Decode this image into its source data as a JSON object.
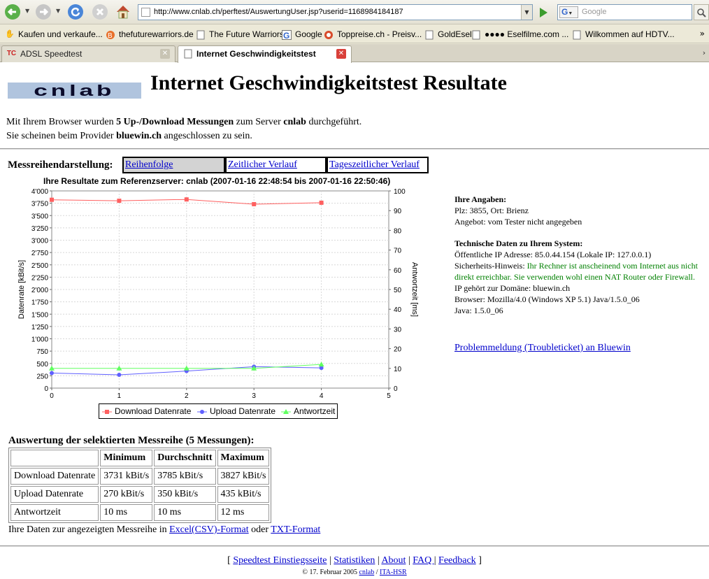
{
  "browser": {
    "url": "http://www.cnlab.ch/perftest/AuswertungUser.jsp?userid=1168984184187",
    "search_placeholder": "Google",
    "search_engine_letter": "G",
    "bookmarks": [
      {
        "label": "Kaufen und verkaufe...",
        "icon": "hand-icon"
      },
      {
        "label": "thefuturewarriors.de",
        "icon": "globe-icon"
      },
      {
        "label": "The Future Warriors",
        "icon": "page-icon"
      },
      {
        "label": "Google",
        "icon": "google-icon"
      },
      {
        "label": "Toppreise.ch - Preisv...",
        "icon": "toppreise-icon"
      },
      {
        "label": "GoldEsel",
        "icon": "page-icon"
      },
      {
        "label": "●●●● Eselfilme.com ...",
        "icon": "page-icon"
      },
      {
        "label": "Wilkommen auf HDTV...",
        "icon": "page-icon"
      }
    ],
    "bookmarks_more": "»",
    "tabs": [
      {
        "label": "ADSL Speedtest",
        "favicon": "TC",
        "active": false
      },
      {
        "label": "Internet Geschwindigkeitstest",
        "favicon": "",
        "active": true
      }
    ]
  },
  "page": {
    "logo_text": "cnlab",
    "title": "Internet Geschwindigkeitstest Resultate",
    "intro": {
      "line1_a": "Mit Ihrem Browser wurden ",
      "line1_b": "5 Up-/Download Messungen",
      "line1_c": " zum Server ",
      "line1_d": "cnlab",
      "line1_e": " durchgeführt.",
      "line2_a": "Sie scheinen beim Provider ",
      "line2_b": "bluewin.ch",
      "line2_c": " angeschlossen zu sein."
    },
    "series_label": "Messreihendarstellung:",
    "series_buttons": [
      "Reihenfolge",
      "Zeitlicher Verlauf",
      "Tageszeitlicher Verlauf"
    ]
  },
  "chart_data": {
    "type": "line",
    "title": "Ihre Resultate zum Referenzserver: cnlab (2007-01-16 22:48:54 bis 2007-01-16 22:50:46)",
    "xlabel": "",
    "ylabel": "Datenrate [kBit/s]",
    "y2label": "Antwortzeit [ms]",
    "x": [
      0,
      1,
      2,
      3,
      4
    ],
    "xlim": [
      0,
      5
    ],
    "xticks": [
      "0",
      "1",
      "2",
      "3",
      "4",
      "5"
    ],
    "ylim": [
      0,
      4000
    ],
    "yticks": [
      "0",
      "250",
      "500",
      "750",
      "1'000",
      "1'250",
      "1'500",
      "1'750",
      "2'000",
      "2'250",
      "2'500",
      "2'750",
      "3'000",
      "3'250",
      "3'500",
      "3'750",
      "4'000"
    ],
    "y2lim": [
      0,
      100
    ],
    "y2ticks": [
      "0",
      "10",
      "20",
      "30",
      "40",
      "50",
      "60",
      "70",
      "80",
      "90",
      "100"
    ],
    "grid": true,
    "legend_position": "bottom",
    "series": [
      {
        "name": "Download Datenrate",
        "axis": "left",
        "color": "#ff6060",
        "marker": "square",
        "values": [
          3820,
          3800,
          3827,
          3731,
          3760
        ]
      },
      {
        "name": "Upload Datenrate",
        "axis": "left",
        "color": "#6060ff",
        "marker": "circle",
        "values": [
          305,
          270,
          345,
          435,
          410
        ]
      },
      {
        "name": "Antwortzeit",
        "axis": "right",
        "color": "#60ff60",
        "marker": "triangle",
        "values": [
          10,
          10,
          10,
          10,
          12
        ]
      }
    ]
  },
  "info": {
    "section1_title": "Ihre Angaben:",
    "plz": "Plz: 3855, Ort: Brienz",
    "offer": "Angebot: vom Tester nicht angegeben",
    "section2_title": "Technische Daten zu Ihrem System:",
    "ip": "Öffentliche IP Adresse: 85.0.44.154 (Lokale IP: 127.0.0.1)",
    "security_label": "Sicherheits-Hinweis: ",
    "security_text": "Ihr Rechner ist anscheinend vom Internet aus nicht direkt erreichbar. Sie verwenden wohl einen NAT Router oder Firewall.",
    "domain": "IP gehört zur Domäne: bluewin.ch",
    "browser": "Browser: Mozilla/4.0 (Windows XP 5.1) Java/1.5.0_06",
    "java": "Java: 1.5.0_06",
    "ticket_link": "Problemmeldung (Troubleticket) an Bluewin"
  },
  "evaluation": {
    "title": "Auswertung der selektierten Messreihe (5 Messungen):",
    "headers": [
      "",
      "Minimum",
      "Durchschnitt",
      "Maximum"
    ],
    "rows": [
      [
        "Download Datenrate",
        "3731 kBit/s",
        "3785 kBit/s",
        "3827 kBit/s"
      ],
      [
        "Upload Datenrate",
        "270 kBit/s",
        "350 kBit/s",
        "435 kBit/s"
      ],
      [
        "Antwortzeit",
        "10 ms",
        "10 ms",
        "12 ms"
      ]
    ],
    "download_prefix": "Ihre Daten zur angezeigten Messreihe in ",
    "download_csv": "Excel(CSV)-Format",
    "download_mid": " oder ",
    "download_txt": "TXT-Format"
  },
  "footer": {
    "open": "[ ",
    "links": [
      "Speedtest Einstiegsseite",
      "Statistiken",
      "About",
      "FAQ ",
      "Feedback"
    ],
    "sep": " | ",
    "close": " ]",
    "copyright_prefix": "© 17. Februar 2005 ",
    "copyright_link1": "cnlab",
    "copyright_sep": " / ",
    "copyright_link2": "ITA-HSR"
  },
  "colors": {
    "logo_bg": "#b0c4de",
    "link": "#0000cc",
    "security_text": "#008000",
    "selected_button": "#d3d3d3"
  }
}
